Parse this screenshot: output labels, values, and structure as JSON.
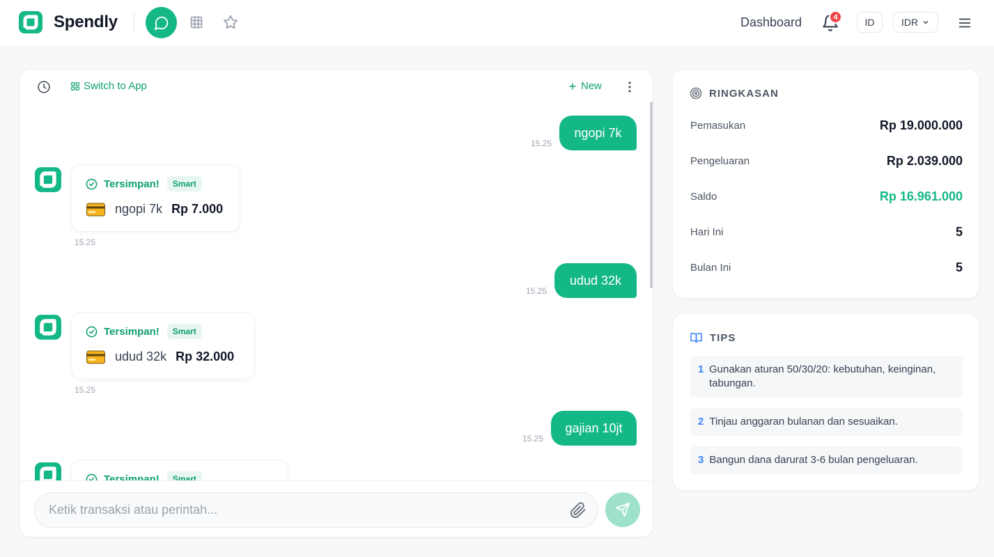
{
  "app": {
    "name": "Spendly",
    "brand_color": "#14b886"
  },
  "header": {
    "dashboard_label": "Dashboard",
    "notification_count": "4",
    "language": "ID",
    "currency": "IDR"
  },
  "chat": {
    "switch_label": "Switch to App",
    "new_label": "New",
    "messages": [
      {
        "type": "user",
        "text": "ngopi 7k",
        "time": "15.25"
      },
      {
        "type": "bot",
        "status": "Tersimpan!",
        "badge": "Smart",
        "item": "ngopi 7k",
        "amount": "Rp 7.000",
        "time": "15.25"
      },
      {
        "type": "user",
        "text": "udud 32k",
        "time": "15.25"
      },
      {
        "type": "bot",
        "status": "Tersimpan!",
        "badge": "Smart",
        "item": "udud 32k",
        "amount": "Rp 32.000",
        "time": "15.25"
      },
      {
        "type": "user",
        "text": "gajian 10jt",
        "time": "15.25"
      },
      {
        "type": "bot",
        "status": "Tersimpan!",
        "badge": "Smart"
      }
    ],
    "input_placeholder": "Ketik transaksi atau perintah..."
  },
  "summary": {
    "title": "RINGKASAN",
    "rows": [
      {
        "label": "Pemasukan",
        "value": "Rp 19.000.000"
      },
      {
        "label": "Pengeluaran",
        "value": "Rp 2.039.000"
      },
      {
        "label": "Saldo",
        "value": "Rp 16.961.000"
      },
      {
        "label": "Hari Ini",
        "value": "5"
      },
      {
        "label": "Bulan Ini",
        "value": "5"
      }
    ]
  },
  "tips": {
    "title": "TIPS",
    "items": [
      {
        "num": "1",
        "text": "Gunakan aturan 50/30/20: kebutuhan, keinginan, tabungan."
      },
      {
        "num": "2",
        "text": "Tinjau anggaran bulanan dan sesuaikan."
      },
      {
        "num": "3",
        "text": "Bangun dana darurat 3-6 bulan pengeluaran."
      }
    ]
  }
}
